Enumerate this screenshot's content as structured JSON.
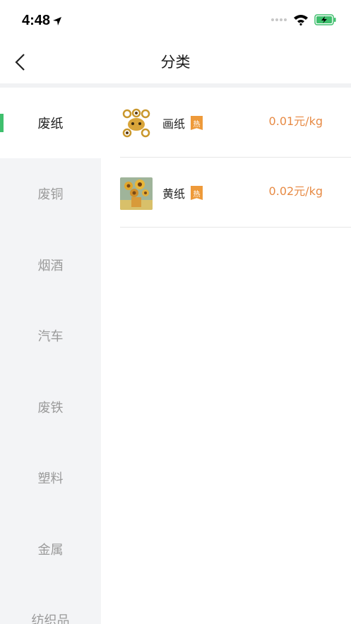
{
  "status": {
    "time": "4:48"
  },
  "nav": {
    "title": "分类"
  },
  "sidebar": {
    "items": [
      {
        "label": "废纸",
        "active": true
      },
      {
        "label": "废铜"
      },
      {
        "label": "烟酒"
      },
      {
        "label": "汽车"
      },
      {
        "label": "废铁"
      },
      {
        "label": "塑料"
      },
      {
        "label": "金属"
      },
      {
        "label": "纺织品"
      }
    ]
  },
  "products": [
    {
      "name": "画纸",
      "badge": "热",
      "price": "0.01元/kg",
      "image": "flower-pattern-icon"
    },
    {
      "name": "黄纸",
      "badge": "热",
      "price": "0.02元/kg",
      "image": "sunflowers-painting"
    }
  ],
  "colors": {
    "accent_green": "#3fbf6d",
    "price_orange": "#e78a44",
    "badge_orange": "#ee9a3a"
  }
}
